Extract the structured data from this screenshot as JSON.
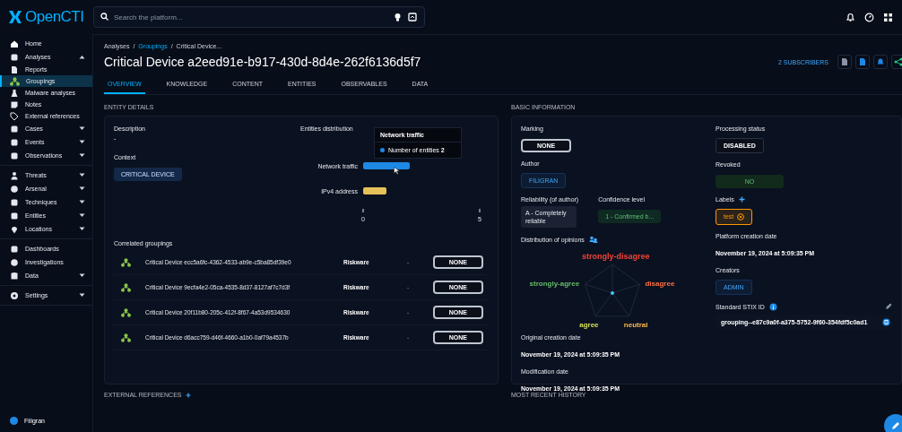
{
  "topbar": {
    "logo": "OpenCTI",
    "search": {
      "placeholder": "Search the platform..."
    }
  },
  "sidebar": {
    "sections": [
      [
        {
          "label": "Home",
          "selected": false
        },
        {
          "label": "Analyses",
          "selected": false,
          "expanded": true,
          "children": [
            {
              "label": "Reports",
              "selected": false
            },
            {
              "label": "Groupings",
              "selected": true
            },
            {
              "label": "Malware analyses",
              "selected": false
            },
            {
              "label": "Notes",
              "selected": false
            },
            {
              "label": "External references",
              "selected": false
            }
          ]
        },
        {
          "label": "Cases",
          "selected": false,
          "expanded": false
        },
        {
          "label": "Events",
          "selected": false,
          "expanded": false
        },
        {
          "label": "Observations",
          "selected": false,
          "expanded": false
        }
      ],
      [
        {
          "label": "Threats",
          "selected": false,
          "expanded": false
        },
        {
          "label": "Arsenal",
          "selected": false,
          "expanded": false
        },
        {
          "label": "Techniques",
          "selected": false,
          "expanded": false
        },
        {
          "label": "Entities",
          "selected": false,
          "expanded": false
        },
        {
          "label": "Locations",
          "selected": false,
          "expanded": false
        }
      ],
      [
        {
          "label": "Dashboards",
          "selected": false
        },
        {
          "label": "Investigations",
          "selected": false
        },
        {
          "label": "Data",
          "selected": false,
          "expanded": false
        }
      ],
      [
        {
          "label": "Settings",
          "selected": false,
          "expanded": false
        }
      ]
    ],
    "footer": {
      "label": "Filigran"
    }
  },
  "breadcrumb": [
    {
      "label": "Analyses",
      "kind": "text"
    },
    {
      "label": "/",
      "kind": "separator"
    },
    {
      "label": "Groupings",
      "kind": "link"
    },
    {
      "label": "/",
      "kind": "separator"
    },
    {
      "label": "Critical Device...",
      "kind": "text"
    }
  ],
  "title": "Critical Device a2eed91e-b917-430d-8d4e-262f6136d5f7",
  "subscribers": "2 SUBSCRIBERS",
  "tabs": [
    {
      "label": "OVERVIEW",
      "selected": true
    },
    {
      "label": "KNOWLEDGE",
      "selected": false
    },
    {
      "label": "CONTENT",
      "selected": false
    },
    {
      "label": "ENTITIES",
      "selected": false
    },
    {
      "label": "OBSERVABLES",
      "selected": false
    },
    {
      "label": "DATA",
      "selected": false
    }
  ],
  "entity_details": {
    "heading": "ENTITY DETAILS",
    "description_label": "Description",
    "description": "-",
    "context_label": "Context",
    "context": "CRITICAL DEVICE",
    "distribution": {
      "label": "Entities distribution",
      "chart_data": {
        "type": "bar",
        "orientation": "horizontal",
        "categories": [
          "Network traffic",
          "IPv4 address"
        ],
        "series": [
          {
            "name": "Number of entities",
            "colors": [
              "#1e88e5",
              "#e6c15a"
            ],
            "values": [
              2,
              1
            ]
          }
        ],
        "xlim": [
          0,
          5
        ],
        "xticks": [
          0,
          5
        ]
      },
      "tooltip": {
        "title": "Network traffic",
        "value": "2"
      }
    },
    "correlated_label": "Correlated groupings",
    "correlated": [
      {
        "name": "Critical Device ecc5a6fc-4362-4533-ab9e-c5ba85df39e0",
        "type": "Riskware",
        "value": "-",
        "marking": "NONE"
      },
      {
        "name": "Critical Device 9ecfa4e2-05ca-4535-8d37-8127af7c7d3f",
        "type": "Riskware",
        "value": "-",
        "marking": "NONE"
      },
      {
        "name": "Critical Device 20f11b80-205c-412f-8f67-4a53d9534630",
        "type": "Riskware",
        "value": "-",
        "marking": "NONE"
      },
      {
        "name": "Critical Device d6acc759-d46f-4660-a1b0-0af79a4537b",
        "type": "Riskware",
        "value": "-",
        "marking": "NONE"
      }
    ]
  },
  "basic_information": {
    "heading": "BASIC INFORMATION",
    "marking_label": "Marking",
    "marking": "NONE",
    "author_label": "Author",
    "author": "FILIGRAN",
    "reliability_label": "Reliability (of author)",
    "reliability": "A - Completely reliable",
    "confidence_label": "Confidence level",
    "confidence": "1 - Confirmed b...",
    "opinions_label": "Distribution of opinions",
    "opinions": [
      {
        "label": "strongly-disagree",
        "color": "#f44336"
      },
      {
        "label": "disagree",
        "color": "#ff7043"
      },
      {
        "label": "neutral",
        "color": "#ffb74d"
      },
      {
        "label": "agree",
        "color": "#d4e157"
      },
      {
        "label": "strongly-agree",
        "color": "#66bb6a"
      }
    ],
    "original_creation_label": "Original creation date",
    "original_creation": "November 19, 2024 at 5:09:35 PM",
    "modification_label": "Modification date",
    "modification": "November 19, 2024 at 5:09:35 PM",
    "processing_label": "Processing status",
    "processing": "DISABLED",
    "revoked_label": "Revoked",
    "revoked": "NO",
    "labels_label": "Labels",
    "labels": [
      {
        "label": "test",
        "color": "#ff9800"
      }
    ],
    "platform_creation_label": "Platform creation date",
    "platform_creation": "November 19, 2024 at 5:09:35 PM",
    "creators_label": "Creators",
    "creators": "ADMIN",
    "stix_label": "Standard STIX ID",
    "stix": "grouping--e87c9a0f-a375-5752-9f60-354fdf5c0ad1"
  },
  "bottom": {
    "left": "EXTERNAL REFERENCES",
    "right": "MOST RECENT HISTORY"
  }
}
